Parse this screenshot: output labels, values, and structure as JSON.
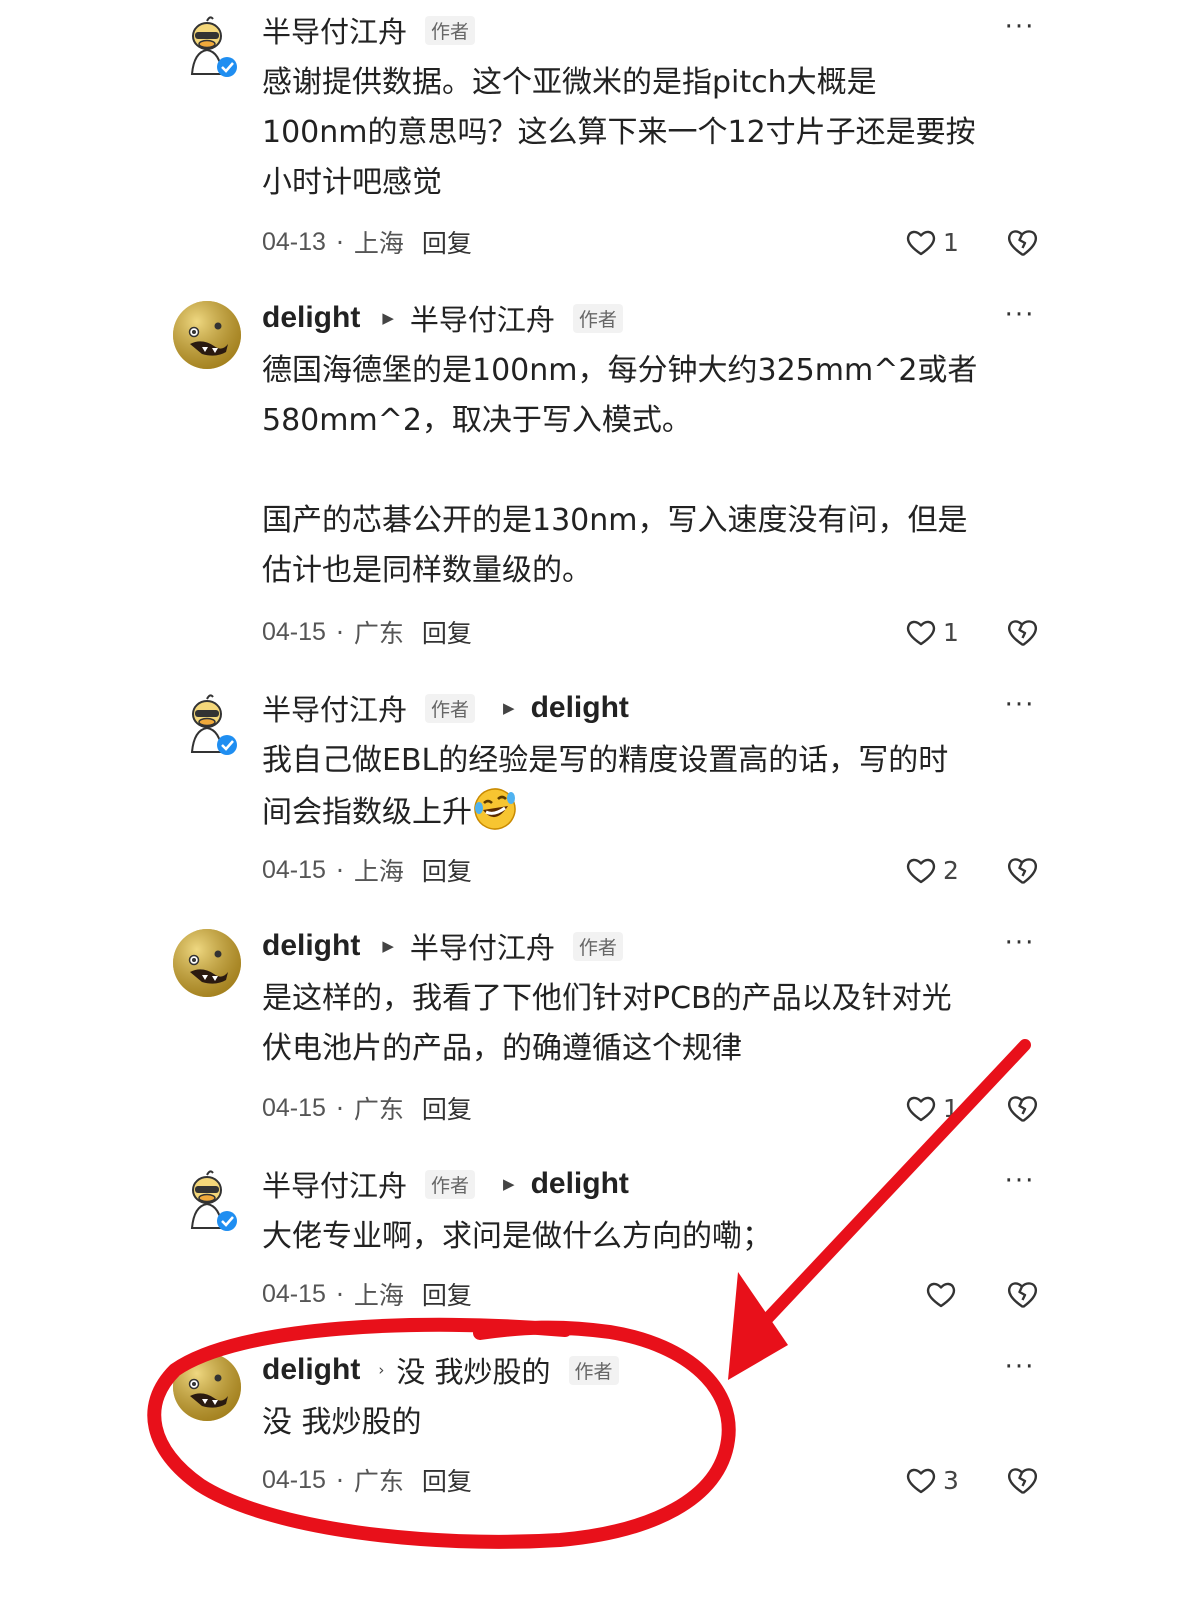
{
  "colors": {
    "annotation": "#e8101a",
    "avatar_duck": "#f4d77a",
    "avatar_delight": "#c9a227"
  },
  "comments": [
    {
      "user": "半导付江舟",
      "author_tag": "作者",
      "reply_to": "",
      "text": "感谢提供数据。这个亚微米的是指pitch大概是\n100nm的意思吗？这么算下来一个12寸片子还是要按\n小时计吧感觉",
      "date": "04-13",
      "location": "上海",
      "reply_label": "回复",
      "likes": "1"
    },
    {
      "user": "delight",
      "reply_to": "半导付江舟",
      "author_tag": "作者",
      "text": "德国海德堡的是100nm，每分钟大约325mm^2或者\n580mm^2，取决于写入模式。\n\n国产的芯碁公开的是130nm，写入速度没有问，但是\n估计也是同样数量级的。",
      "date": "04-15",
      "location": "广东",
      "reply_label": "回复",
      "likes": "1"
    },
    {
      "user": "半导付江舟",
      "author_tag": "作者",
      "reply_to": "delight",
      "text": "我自己做EBL的经验是写的精度设置高的话，写的时\n间会指数级上升",
      "emoji": "laughing-crying-emoji",
      "date": "04-15",
      "location": "上海",
      "reply_label": "回复",
      "likes": "2"
    },
    {
      "user": "delight",
      "reply_to": "半导付江舟",
      "author_tag": "作者",
      "text": "是这样的，我看了下他们针对PCB的产品以及针对光\n伏电池片的产品，的确遵循这个规律",
      "date": "04-15",
      "location": "广东",
      "reply_label": "回复",
      "likes": "1"
    },
    {
      "user": "半导付江舟",
      "author_tag": "作者",
      "reply_to": "delight",
      "text": "大佬专业啊，求问是做什么方向的嘞；",
      "date": "04-15",
      "location": "上海",
      "reply_label": "回复",
      "likes": ""
    },
    {
      "user": "delight",
      "reply_to": "没 我炒股的",
      "author_tag": "作者",
      "text": "没 我炒股的",
      "date": "04-15",
      "location": "广东",
      "reply_label": "回复",
      "likes": "3"
    }
  ]
}
